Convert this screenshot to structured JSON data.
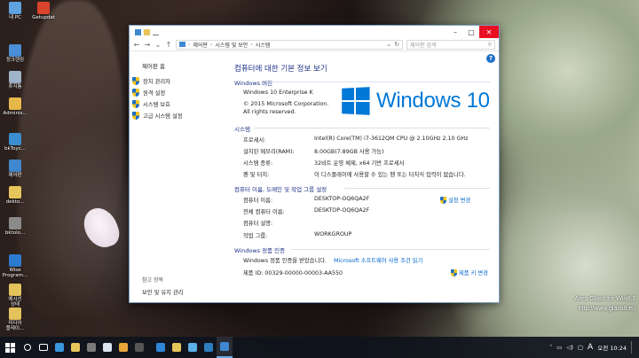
{
  "desktop": {
    "icons": [
      {
        "label": "내 PC",
        "color": "#5fa3e0"
      },
      {
        "label": "Getupdat",
        "color": "#d9442c"
      },
      {
        "label": "정크렌징",
        "color": "#4a8fd6"
      },
      {
        "label": "휴지통",
        "color": "#9fb4c8"
      },
      {
        "label": "Adminis...",
        "color": "#e6b84a"
      },
      {
        "label": "bkToyc...",
        "color": "#3a8ed0"
      },
      {
        "label": "제어판",
        "color": "#3f88d0"
      },
      {
        "label": "dekto...",
        "color": "#e6c65a"
      },
      {
        "label": "bktolo...",
        "color": "#8a8a8a"
      },
      {
        "label": "Wise\nProgram...",
        "color": "#2d7bd0"
      },
      {
        "label": "예시선\n상태",
        "color": "#e4c35c"
      },
      {
        "label": "미디어\n플레이...",
        "color": "#e4c35c"
      }
    ]
  },
  "window": {
    "address": {
      "crumbs": [
        "제어판",
        "시스템 및 보안",
        "시스템"
      ],
      "search_placeholder": "제어판 검색"
    },
    "left_pane": {
      "home": "제어판 홈",
      "links": [
        "장치 관리자",
        "원격 설정",
        "시스템 보호",
        "고급 시스템 설정"
      ],
      "see_also": "참고 항목",
      "security": "보안 및 유지 관리"
    },
    "main": {
      "title": "컴퓨터에 대한 기본 정보 보기",
      "edition_header": "Windows 버전",
      "edition": "Windows 10 Enterprise K",
      "copyright": "© 2015 Microsoft Corporation. All rights reserved.",
      "logo_text": "Windows 10",
      "system_header": "시스템",
      "system": [
        {
          "label": "프로세서:",
          "value": "Intel(R) Core(TM) i7-3612QM CPU @ 2.10GHz   2.10 GHz"
        },
        {
          "label": "설치된 메모리(RAM):",
          "value": "8.00GB(7.89GB 사용 가능)"
        },
        {
          "label": "시스템 종류:",
          "value": "32비트 운영 체제, x64 기반 프로세서"
        },
        {
          "label": "펜 및 터치:",
          "value": "이 디스플레이에 사용할 수 있는 펜 또는 터치식 입력이 없습니다."
        }
      ],
      "name_header": "컴퓨터 이름, 도메인 및 작업 그룹 설정",
      "name_rows": [
        {
          "label": "컴퓨터 이름:",
          "value": "DESKTOP-OQ6QA2F"
        },
        {
          "label": "전체 컴퓨터 이름:",
          "value": "DESKTOP-OQ6QA2F"
        },
        {
          "label": "컴퓨터 설명:",
          "value": ""
        },
        {
          "label": "작업 그룹:",
          "value": "WORKGROUP"
        }
      ],
      "change_settings": "설정 변경",
      "activation_header": "Windows 정품 인증",
      "activation_status": "Windows 정품 인증을 받았습니다.",
      "license_link": "Microsoft 소프트웨어 사용 조건 읽기",
      "product_id": "제품 ID: 00329-00000-00003-AA550",
      "change_key": "제품 키 변경"
    }
  },
  "taskbar": {
    "time": "10:24",
    "ampm": "오전",
    "ime": "A"
  },
  "watermark": {
    "line1": "Aero Glass for Win8.1",
    "line2": "http://www.glass8.eu"
  }
}
